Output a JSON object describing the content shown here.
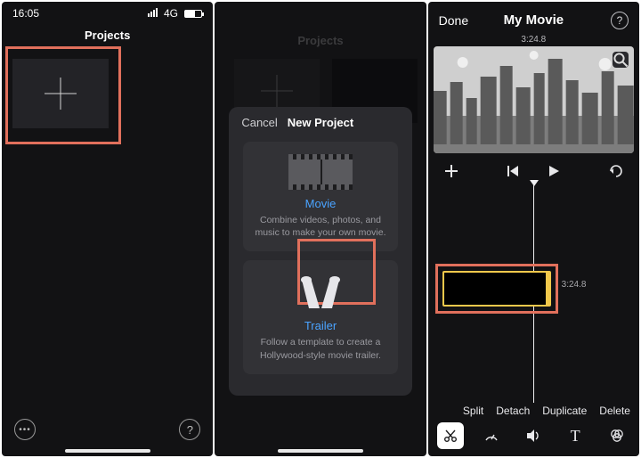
{
  "panel1": {
    "status": {
      "time": "16:05",
      "network": "4G"
    },
    "title": "Projects",
    "more_label": "•••",
    "help_label": "?"
  },
  "panel2": {
    "dim_title": "Projects",
    "sheet": {
      "cancel": "Cancel",
      "title": "New Project",
      "movie": {
        "label": "Movie",
        "desc": "Combine videos, photos, and music to make your own movie."
      },
      "trailer": {
        "label": "Trailer",
        "desc": "Follow a template to create a Hollywood-style movie trailer."
      }
    }
  },
  "panel3": {
    "done": "Done",
    "title": "My Movie",
    "help": "?",
    "timecode": "3:24.8",
    "clip_time": "3:24.8",
    "actions": {
      "split": "Split",
      "detach": "Detach",
      "duplicate": "Duplicate",
      "delete": "Delete"
    }
  }
}
